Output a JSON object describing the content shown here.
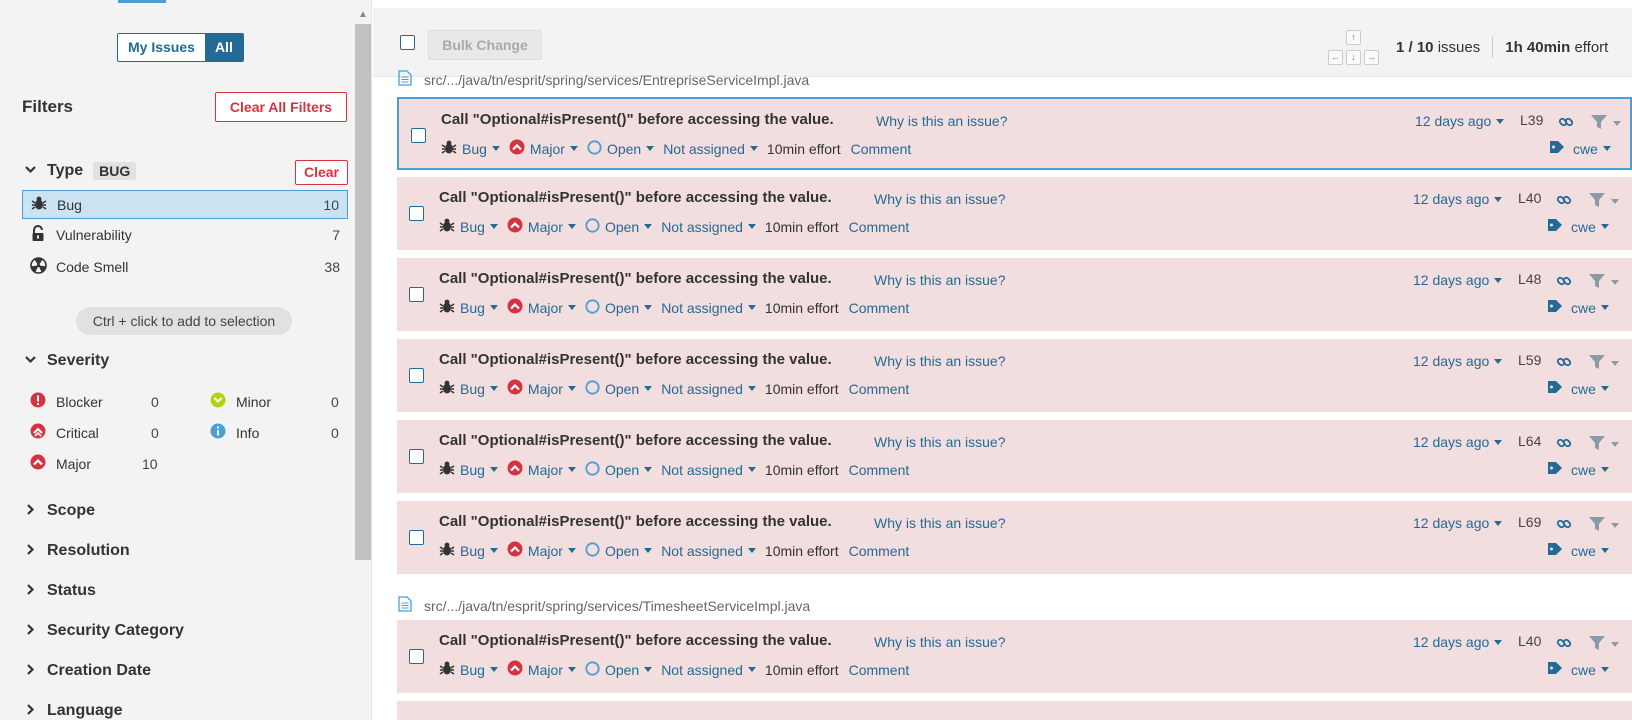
{
  "sidebar": {
    "toggle": {
      "my_issues": "My Issues",
      "all": "All"
    },
    "filters_title": "Filters",
    "clear_all": "Clear All Filters",
    "type_facet": {
      "title": "Type",
      "chip": "BUG",
      "clear": "Clear",
      "items": [
        {
          "label": "Bug",
          "count": "10",
          "icon": "bug-icon",
          "selected": true
        },
        {
          "label": "Vulnerability",
          "count": "7",
          "icon": "lock-open-icon",
          "selected": false
        },
        {
          "label": "Code Smell",
          "count": "38",
          "icon": "radiation-icon",
          "selected": false
        }
      ]
    },
    "hint": "Ctrl + click to add to selection",
    "severity_facet": {
      "title": "Severity",
      "items": [
        {
          "label": "Blocker",
          "count": "0",
          "icon": "blocker-icon"
        },
        {
          "label": "Minor",
          "count": "0",
          "icon": "minor-icon"
        },
        {
          "label": "Critical",
          "count": "0",
          "icon": "critical-icon"
        },
        {
          "label": "Info",
          "count": "0",
          "icon": "info-icon"
        },
        {
          "label": "Major",
          "count": "10",
          "icon": "major-icon"
        }
      ]
    },
    "collapsed_facets": [
      "Scope",
      "Resolution",
      "Status",
      "Security Category",
      "Creation Date",
      "Language"
    ]
  },
  "toolbar": {
    "bulk_change": "Bulk Change",
    "page_current": "1 / 10",
    "issues_label": "issues",
    "effort_value": "1h 40min",
    "effort_label": "effort",
    "kbd_up": "↑",
    "kbd_left": "←",
    "kbd_down": "↓",
    "kbd_right": "→"
  },
  "files": [
    {
      "path": "src/.../java/tn/esprit/spring/services/EntrepriseServiceImpl.java"
    },
    {
      "path": "src/.../java/tn/esprit/spring/services/TimesheetServiceImpl.java"
    }
  ],
  "issues": [
    {
      "message": "Call \"Optional#isPresent()\" before accessing the value.",
      "why": "Why is this an issue?",
      "type": "Bug",
      "severity": "Major",
      "status": "Open",
      "assignee": "Not assigned",
      "effort": "10min effort",
      "comment": "Comment",
      "ago": "12 days ago",
      "line": "L39",
      "tags": "cwe"
    },
    {
      "message": "Call \"Optional#isPresent()\" before accessing the value.",
      "why": "Why is this an issue?",
      "type": "Bug",
      "severity": "Major",
      "status": "Open",
      "assignee": "Not assigned",
      "effort": "10min effort",
      "comment": "Comment",
      "ago": "12 days ago",
      "line": "L40",
      "tags": "cwe"
    },
    {
      "message": "Call \"Optional#isPresent()\" before accessing the value.",
      "why": "Why is this an issue?",
      "type": "Bug",
      "severity": "Major",
      "status": "Open",
      "assignee": "Not assigned",
      "effort": "10min effort",
      "comment": "Comment",
      "ago": "12 days ago",
      "line": "L48",
      "tags": "cwe"
    },
    {
      "message": "Call \"Optional#isPresent()\" before accessing the value.",
      "why": "Why is this an issue?",
      "type": "Bug",
      "severity": "Major",
      "status": "Open",
      "assignee": "Not assigned",
      "effort": "10min effort",
      "comment": "Comment",
      "ago": "12 days ago",
      "line": "L59",
      "tags": "cwe"
    },
    {
      "message": "Call \"Optional#isPresent()\" before accessing the value.",
      "why": "Why is this an issue?",
      "type": "Bug",
      "severity": "Major",
      "status": "Open",
      "assignee": "Not assigned",
      "effort": "10min effort",
      "comment": "Comment",
      "ago": "12 days ago",
      "line": "L64",
      "tags": "cwe"
    },
    {
      "message": "Call \"Optional#isPresent()\" before accessing the value.",
      "why": "Why is this an issue?",
      "type": "Bug",
      "severity": "Major",
      "status": "Open",
      "assignee": "Not assigned",
      "effort": "10min effort",
      "comment": "Comment",
      "ago": "12 days ago",
      "line": "L69",
      "tags": "cwe"
    },
    {
      "message": "Call \"Optional#isPresent()\" before accessing the value.",
      "why": "Why is this an issue?",
      "type": "Bug",
      "severity": "Major",
      "status": "Open",
      "assignee": "Not assigned",
      "effort": "10min effort",
      "comment": "Comment",
      "ago": "12 days ago",
      "line": "L40",
      "tags": "cwe"
    }
  ],
  "colors": {
    "brand_blue": "#236a97",
    "accent_blue": "#4b9fd5",
    "danger_red": "#d4333f",
    "issue_bg": "#f2dede",
    "minor_green": "#b0d513",
    "panel_grey": "#f3f3f3"
  }
}
